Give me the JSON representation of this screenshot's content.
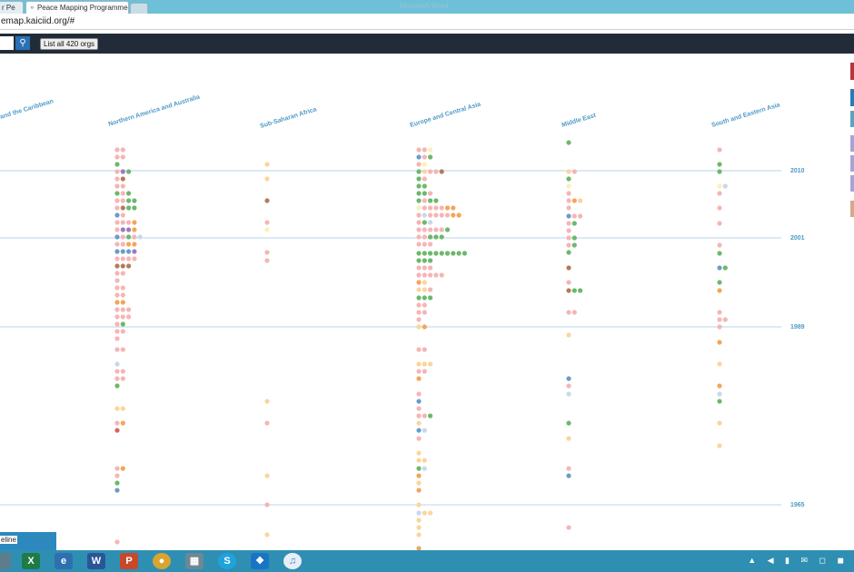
{
  "browser": {
    "tabs": [
      {
        "label": "r Pe"
      },
      {
        "label": "Peace Mapping Programme",
        "favicon": "link-icon"
      }
    ],
    "window_title": "Microsoft Word",
    "address": "emap.kaiciid.org/#"
  },
  "toolbar": {
    "search_icon": "search-icon",
    "list_all_label": "List all 420 orgs"
  },
  "timeline_button_label": "eline",
  "years": [
    "2010",
    "2001",
    "1989",
    "1965"
  ],
  "regions": [
    "and the Caribbean",
    "Northern America and Australia",
    "Sub-Saharan Africa",
    "Europe and Central Asia",
    "Middle East",
    "South and Eastern Asia"
  ],
  "legend_colors": [
    "#b8333c",
    "#2a7ab5",
    "#5ba3c1",
    "#a7a3d6",
    "#a7a3d6",
    "#a7a3d6",
    "#d4a88c"
  ],
  "dot_palette": {
    "p": "#f6b5b5",
    "g": "#6cb86c",
    "o": "#f2a65a",
    "y": "#fad59d",
    "b": "#6c9bcb",
    "l": "#c7d8ea",
    "v": "#9c7bb8",
    "r": "#e06060",
    "m": "#b57a58",
    "c": "#fbf1b5"
  },
  "taskbar": {
    "icons": [
      "excel-icon",
      "ie-icon",
      "word-icon",
      "powerpoint-icon",
      "chrome-icon",
      "calculator-icon",
      "skype-icon",
      "dropbox-icon",
      "itunes-icon"
    ],
    "tray": "▲ ◀ ▮ ✉ ◻ ◼"
  },
  "columns": [
    {
      "region": "Northern America and Australia",
      "rows": [
        [
          165,
          "pp"
        ],
        [
          173,
          "pp"
        ],
        [
          181,
          "g"
        ],
        [
          189,
          "pvg"
        ],
        [
          197,
          "pm"
        ],
        [
          205,
          "pp"
        ],
        [
          213,
          "gpg"
        ],
        [
          221,
          "ppgg"
        ],
        [
          229,
          "pmgg"
        ],
        [
          237,
          "bp"
        ],
        [
          245,
          "pppo"
        ],
        [
          253,
          "pvvo"
        ],
        [
          261,
          "bpgpl"
        ],
        [
          269,
          "ppoo"
        ],
        [
          277,
          "bbbv"
        ],
        [
          285,
          "pppp"
        ],
        [
          293,
          "mmm"
        ],
        [
          301,
          "pp"
        ],
        [
          309,
          "p"
        ],
        [
          317,
          "pp"
        ],
        [
          325,
          "pp"
        ],
        [
          333,
          "oo"
        ],
        [
          341,
          "ppp"
        ],
        [
          349,
          "ppp"
        ],
        [
          357,
          "pg"
        ],
        [
          365,
          "pp"
        ],
        [
          373,
          "p"
        ],
        [
          385,
          "pp"
        ],
        [
          401,
          "l"
        ],
        [
          409,
          "pp"
        ],
        [
          417,
          "pp"
        ],
        [
          425,
          "g"
        ],
        [
          450,
          "yy"
        ],
        [
          466,
          "po"
        ],
        [
          474,
          "r"
        ],
        [
          516,
          "po"
        ],
        [
          524,
          "p"
        ],
        [
          532,
          "g"
        ],
        [
          540,
          "b"
        ],
        [
          597,
          "p"
        ]
      ]
    },
    {
      "region": "Sub-Saharan Africa",
      "rows": [
        [
          181,
          "y"
        ],
        [
          197,
          "y"
        ],
        [
          221,
          "m"
        ],
        [
          245,
          "p"
        ],
        [
          253,
          "c"
        ],
        [
          278,
          "p"
        ],
        [
          287,
          "p"
        ],
        [
          442,
          "y"
        ],
        [
          466,
          "p"
        ],
        [
          524,
          "y"
        ],
        [
          556,
          "p"
        ],
        [
          589,
          "y"
        ]
      ]
    },
    {
      "region": "Europe and Central Asia",
      "rows": [
        [
          165,
          "ppc"
        ],
        [
          173,
          "bpg"
        ],
        [
          181,
          "pc"
        ],
        [
          189,
          "gyppm"
        ],
        [
          197,
          "gp"
        ],
        [
          205,
          "gg"
        ],
        [
          213,
          "ggp"
        ],
        [
          221,
          "gpgg"
        ],
        [
          229,
          "cppppoo"
        ],
        [
          237,
          "plppppoo"
        ],
        [
          245,
          "pgl"
        ],
        [
          253,
          "pppppg"
        ],
        [
          261,
          "ppggg"
        ],
        [
          269,
          "ppp"
        ],
        [
          279,
          "ggggggggg"
        ],
        [
          287,
          "ggg"
        ],
        [
          295,
          "ppp"
        ],
        [
          303,
          "ppppp"
        ],
        [
          311,
          "oy"
        ],
        [
          319,
          "yyp"
        ],
        [
          328,
          "ggg"
        ],
        [
          336,
          "pp"
        ],
        [
          344,
          "pp"
        ],
        [
          352,
          "p"
        ],
        [
          360,
          "yo"
        ],
        [
          385,
          "pp"
        ],
        [
          401,
          "yyy"
        ],
        [
          409,
          "pp"
        ],
        [
          417,
          "o"
        ],
        [
          434,
          "p"
        ],
        [
          442,
          "b"
        ],
        [
          450,
          "p"
        ],
        [
          458,
          "ppg"
        ],
        [
          466,
          "y"
        ],
        [
          474,
          "bl"
        ],
        [
          483,
          "p"
        ],
        [
          499,
          "y"
        ],
        [
          507,
          "yy"
        ],
        [
          516,
          "gl"
        ],
        [
          524,
          "o"
        ],
        [
          532,
          "y"
        ],
        [
          540,
          "o"
        ],
        [
          556,
          "y"
        ],
        [
          565,
          "lyy"
        ],
        [
          573,
          "y"
        ],
        [
          581,
          "y"
        ],
        [
          589,
          "y"
        ],
        [
          604,
          "o"
        ]
      ]
    },
    {
      "region": "Middle East",
      "rows": [
        [
          157,
          "g"
        ],
        [
          189,
          "yp"
        ],
        [
          197,
          "g"
        ],
        [
          205,
          "c"
        ],
        [
          213,
          "p"
        ],
        [
          221,
          "poy"
        ],
        [
          229,
          "p"
        ],
        [
          238,
          "bpp"
        ],
        [
          246,
          "pg"
        ],
        [
          254,
          "p"
        ],
        [
          262,
          "pg"
        ],
        [
          270,
          "pg"
        ],
        [
          278,
          "g"
        ],
        [
          295,
          "m"
        ],
        [
          311,
          "p"
        ],
        [
          320,
          "mgg"
        ],
        [
          344,
          "pp"
        ],
        [
          369,
          "y"
        ],
        [
          417,
          "b"
        ],
        [
          425,
          "p"
        ],
        [
          434,
          "l"
        ],
        [
          466,
          "g"
        ],
        [
          483,
          "y"
        ],
        [
          516,
          "p"
        ],
        [
          524,
          "b"
        ],
        [
          581,
          "p"
        ]
      ]
    },
    {
      "region": "South and Eastern Asia",
      "rows": [
        [
          165,
          "p"
        ],
        [
          181,
          "g"
        ],
        [
          189,
          "g"
        ],
        [
          205,
          "cl"
        ],
        [
          213,
          "p"
        ],
        [
          229,
          "p"
        ],
        [
          246,
          "p"
        ],
        [
          270,
          "p"
        ],
        [
          279,
          "g"
        ],
        [
          295,
          "bg"
        ],
        [
          311,
          "g"
        ],
        [
          320,
          "o"
        ],
        [
          344,
          "p"
        ],
        [
          352,
          "pp"
        ],
        [
          360,
          "p"
        ],
        [
          377,
          "o"
        ],
        [
          401,
          "y"
        ],
        [
          425,
          "o"
        ],
        [
          434,
          "l"
        ],
        [
          442,
          "g"
        ],
        [
          466,
          "y"
        ],
        [
          491,
          "y"
        ]
      ]
    }
  ]
}
